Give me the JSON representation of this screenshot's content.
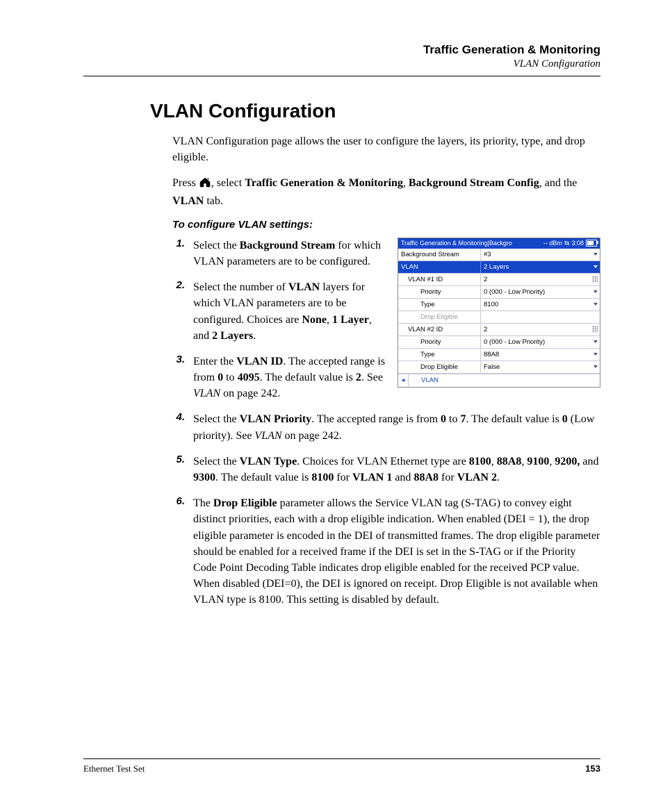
{
  "header": {
    "chapter": "Traffic Generation & Monitoring",
    "breadcrumb": "VLAN Configuration"
  },
  "section_title": "VLAN Configuration",
  "intro": "VLAN Configuration page allows the user to configure the layers, its priority, type, and drop eligible.",
  "nav_sentence": {
    "pre": "Press ",
    "mid1": ", select ",
    "b1": "Traffic Generation & Monitoring",
    "mid2": ", ",
    "b2": "Background Stream Config",
    "mid3": ", and the ",
    "b3": "VLAN",
    "post": " tab."
  },
  "subhead": "To configure VLAN settings:",
  "steps": [
    {
      "n": "1.",
      "html": "Select the <b>Background Stream</b> for which VLAN parameters are to be configured."
    },
    {
      "n": "2.",
      "html": "Select the number of <b>VLAN</b> layers for which VLAN parameters are to be configured. Choices are <b>None</b>, <b>1 Layer</b>, and <b>2 Layers</b>."
    },
    {
      "n": "3.",
      "html": "Enter the <b>VLAN ID</b>. The accepted range is from <b>0</b> to <b>4095</b>. The default value is <b>2</b>. See <i>VLAN</i> on page 242."
    },
    {
      "n": "4.",
      "html": "Select the <b>VLAN Priority</b>. The accepted range is from <b>0</b> to <b>7</b>. The default value is <b>0</b> (Low priority). See <i>VLAN</i> on page 242."
    },
    {
      "n": "5.",
      "html": "Select the <b>VLAN Type</b>. Choices for VLAN Ethernet type are <b>8100</b>, <b>88A8</b>, <b>9100</b>, <b>9200,</b> and <b>9300</b>. The default value is <b>8100</b> for <b>VLAN 1</b> and <b>88A8</b> for <b>VLAN 2</b>."
    },
    {
      "n": "6.",
      "html": "The <b>Drop Eligible</b> parameter allows the Service VLAN tag (S-TAG) to convey eight distinct priorities, each with a drop eligible indication. When enabled (DEI = 1), the drop eligible parameter is encoded in the DEI of transmitted frames. The drop eligible parameter should be enabled for a received frame if the DEI is set in the S-TAG or if the Priority Code Point Decoding Table indicates drop eligible enabled for the received PCP value. When disabled (DEI=0), the DEI is ignored on receipt. Drop Eligible is not available when VLAN type is 8100. This setting is disabled by default."
    }
  ],
  "screenshot": {
    "title": "Traffic Generation  &  Monitoring|Backgro",
    "signal": "-- dBm",
    "time": "3:08",
    "rows": [
      {
        "label": "Background Stream",
        "value": "#3",
        "kind": "dd",
        "ind": 0
      },
      {
        "label": "VLAN",
        "value": "2 Layers",
        "kind": "dd",
        "ind": 0,
        "sel": true
      },
      {
        "label": "VLAN #1 ID",
        "value": "2",
        "kind": "grip",
        "ind": 1
      },
      {
        "label": "Priority",
        "value": "0 (000 - Low Priority)",
        "kind": "dd",
        "ind": 2
      },
      {
        "label": "Type",
        "value": "8100",
        "kind": "dd",
        "ind": 2
      },
      {
        "label": "Drop Eligible",
        "value": "",
        "kind": "",
        "ind": 2,
        "dis": true
      },
      {
        "label": "VLAN #2 ID",
        "value": "2",
        "kind": "grip",
        "ind": 1
      },
      {
        "label": "Priority",
        "value": "0 (000 - Low Priority)",
        "kind": "dd",
        "ind": 2
      },
      {
        "label": "Type",
        "value": "88A8",
        "kind": "dd",
        "ind": 2
      },
      {
        "label": "Drop Eligible",
        "value": "False",
        "kind": "dd",
        "ind": 2
      }
    ],
    "tab": "VLAN"
  },
  "footer": {
    "doc": "Ethernet Test Set",
    "page": "153"
  }
}
